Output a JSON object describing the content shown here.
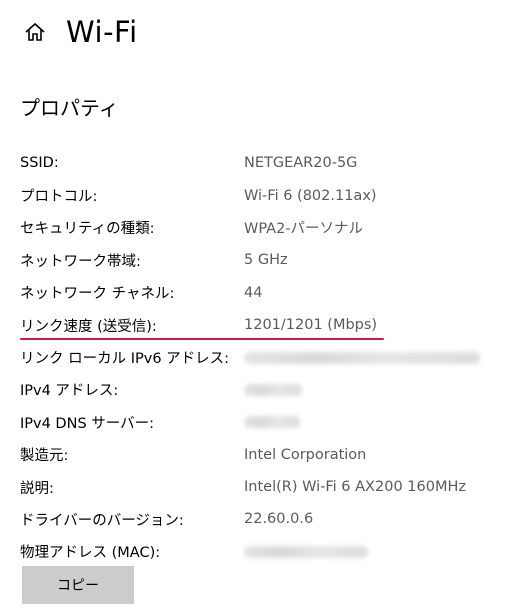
{
  "header": {
    "title": "Wi-Fi",
    "home_icon": "home-icon"
  },
  "section": {
    "title": "プロパティ"
  },
  "properties": [
    {
      "label": "SSID:",
      "value": "NETGEAR20-5G"
    },
    {
      "label": "プロトコル:",
      "value": "Wi-Fi 6 (802.11ax)"
    },
    {
      "label": "セキュリティの種類:",
      "value": "WPA2-パーソナル"
    },
    {
      "label": "ネットワーク帯域:",
      "value": "5 GHz"
    },
    {
      "label": "ネットワーク チャネル:",
      "value": "44"
    },
    {
      "label": "リンク速度 (送受信):",
      "value": "1201/1201 (Mbps)"
    },
    {
      "label": "リンク ローカル IPv6 アドレス:",
      "value": ""
    },
    {
      "label": "IPv4 アドレス:",
      "value": ""
    },
    {
      "label": "IPv4 DNS サーバー:",
      "value": ""
    },
    {
      "label": "製造元:",
      "value": "Intel Corporation"
    },
    {
      "label": "説明:",
      "value": "Intel(R) Wi-Fi 6 AX200 160MHz"
    },
    {
      "label": "ドライバーのバージョン:",
      "value": "22.60.0.6"
    },
    {
      "label": "物理アドレス (MAC):",
      "value": ""
    }
  ],
  "copy_button": {
    "label": "コピー"
  },
  "colors": {
    "highlight": "#d6125a",
    "value_text": "#5a5a5a",
    "button_bg": "#cccccc"
  }
}
